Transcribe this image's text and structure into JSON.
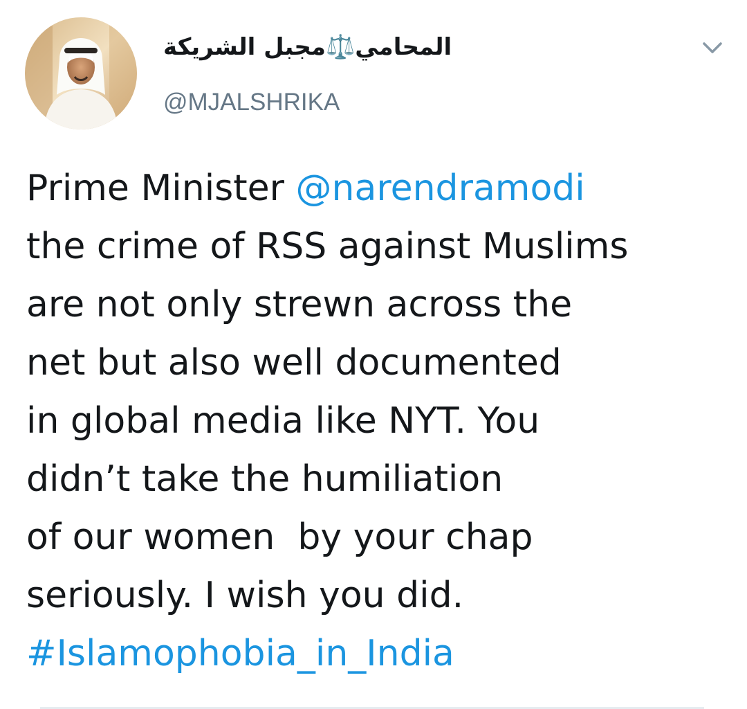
{
  "tweet": {
    "author": {
      "display_name": "المحامي⚖️مجبل الشريكة",
      "handle": "@MJALSHRIKA"
    },
    "menu_icon": "chevron-down-icon",
    "text": {
      "line1_prefix": "Prime Minister ",
      "mention": "@narendramodi",
      "line2": "the crime of RSS against Muslims",
      "line3": "are not only strewn across the",
      "line4": "net but also well documented",
      "line5": "in global media like NYT. You",
      "line6": "didn’t take the humiliation",
      "line7": "of our women  by your chap",
      "line8": "seriously. I wish you did.",
      "hashtag": "#Islamophobia_in_India"
    },
    "colors": {
      "link": "#1b95e0",
      "text": "#14171a",
      "secondary": "#657786"
    }
  }
}
